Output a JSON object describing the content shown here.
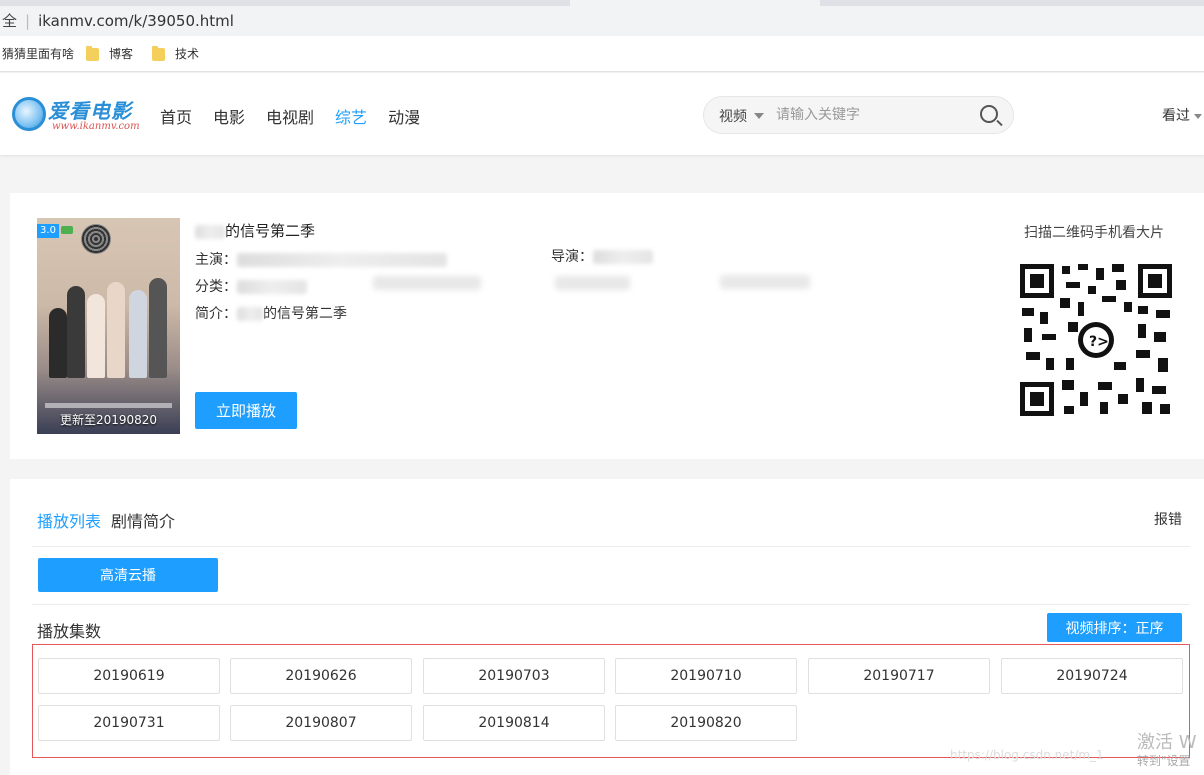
{
  "browser": {
    "security_label": "全",
    "url": "ikanmv.com/k/39050.html",
    "bookmarks": [
      {
        "label": "猜猜里面有啥",
        "icon": "none"
      },
      {
        "label": "博客",
        "icon": "folder-icon"
      },
      {
        "label": "技术",
        "icon": "folder-icon"
      }
    ]
  },
  "header": {
    "logo_text": "爱看电影",
    "logo_url": "www.ikanmv.com",
    "nav": [
      "首页",
      "电影",
      "电视剧",
      "综艺",
      "动漫"
    ],
    "nav_active": "综艺",
    "search_type": "视频",
    "search_placeholder": "请输入关键字",
    "history_label": "看过"
  },
  "detail": {
    "title": "的信号第二季",
    "score": "3.0",
    "update_text": "更新至20190820",
    "cast_label": "主演：",
    "category_label": "分类：",
    "intro_label": "简介：",
    "intro_value": "的信号第二季",
    "director_label": "导演：",
    "play_button": "立即播放",
    "qr_title": "扫描二维码手机看大片"
  },
  "playlist": {
    "tabs": [
      "播放列表",
      "剧情简介"
    ],
    "report": "报错",
    "source_button": "高清云播",
    "episodes_label": "播放集数",
    "sort_button": "视频排序：正序",
    "episodes": [
      "20190619",
      "20190626",
      "20190703",
      "20190710",
      "20190717",
      "20190724",
      "20190731",
      "20190807",
      "20190814",
      "20190820"
    ]
  },
  "overlay": {
    "activate": "激活 W",
    "activate_sub": "转到\"设置",
    "csdn": "https://blog.csdn.net/m_1"
  },
  "colors": {
    "accent": "#1e9fff",
    "highlight_border": "#e5575a"
  }
}
